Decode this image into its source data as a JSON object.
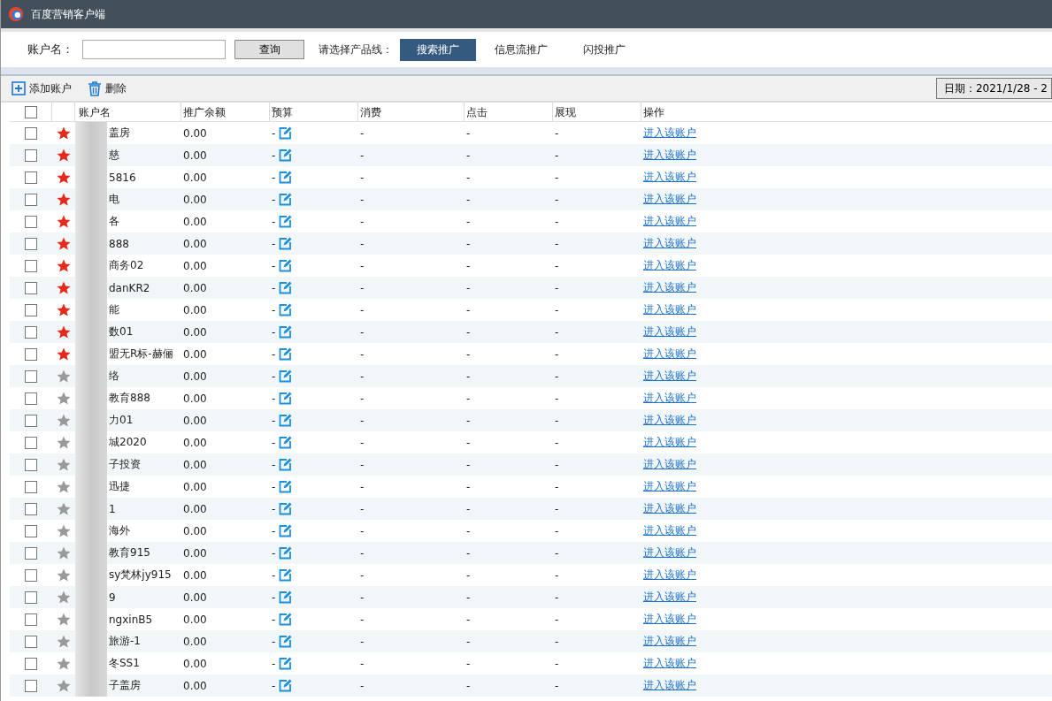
{
  "window": {
    "title": "百度营销客户端"
  },
  "search": {
    "label": "账户名：",
    "button": "查询"
  },
  "product_line": {
    "label": "请选择产品线：",
    "tabs": [
      {
        "label": "搜索推广",
        "selected": true
      },
      {
        "label": "信息流推广",
        "selected": false
      },
      {
        "label": "闪投推广",
        "selected": false
      }
    ]
  },
  "actions": [
    {
      "label": "添加账户",
      "kind": "add"
    },
    {
      "label": "删除",
      "kind": "delete"
    }
  ],
  "date_button": "日期：2021/1/28 - 2",
  "table": {
    "all_checked": false,
    "columns": [
      "账户名",
      "推广余额",
      "预算",
      "消费",
      "点击",
      "展现",
      "操作"
    ],
    "rows": [
      {
        "checked": false,
        "starred": true,
        "name": "盖房",
        "balance": "0.00",
        "budget": "-",
        "spend": "-",
        "clicks": "-",
        "impressions": "-",
        "action": "进入该账户"
      },
      {
        "checked": false,
        "starred": true,
        "name": "慈",
        "balance": "0.00",
        "budget": "-",
        "spend": "-",
        "clicks": "-",
        "impressions": "-",
        "action": "进入该账户"
      },
      {
        "checked": false,
        "starred": true,
        "name": "5816",
        "balance": "0.00",
        "budget": "-",
        "spend": "-",
        "clicks": "-",
        "impressions": "-",
        "action": "进入该账户"
      },
      {
        "checked": false,
        "starred": true,
        "name": "电",
        "balance": "0.00",
        "budget": "-",
        "spend": "-",
        "clicks": "-",
        "impressions": "-",
        "action": "进入该账户"
      },
      {
        "checked": false,
        "starred": true,
        "name": "各",
        "balance": "0.00",
        "budget": "-",
        "spend": "-",
        "clicks": "-",
        "impressions": "-",
        "action": "进入该账户"
      },
      {
        "checked": false,
        "starred": true,
        "name": "888",
        "balance": "0.00",
        "budget": "-",
        "spend": "-",
        "clicks": "-",
        "impressions": "-",
        "action": "进入该账户"
      },
      {
        "checked": false,
        "starred": true,
        "name": "商务02",
        "balance": "0.00",
        "budget": "-",
        "spend": "-",
        "clicks": "-",
        "impressions": "-",
        "action": "进入该账户"
      },
      {
        "checked": false,
        "starred": true,
        "name": "danKR2",
        "balance": "0.00",
        "budget": "-",
        "spend": "-",
        "clicks": "-",
        "impressions": "-",
        "action": "进入该账户"
      },
      {
        "checked": false,
        "starred": true,
        "name": "能",
        "balance": "0.00",
        "budget": "-",
        "spend": "-",
        "clicks": "-",
        "impressions": "-",
        "action": "进入该账户"
      },
      {
        "checked": false,
        "starred": true,
        "name": "数01",
        "balance": "0.00",
        "budget": "-",
        "spend": "-",
        "clicks": "-",
        "impressions": "-",
        "action": "进入该账户"
      },
      {
        "checked": false,
        "starred": true,
        "name": "盟无R标-赫俪",
        "balance": "0.00",
        "budget": "-",
        "spend": "-",
        "clicks": "-",
        "impressions": "-",
        "action": "进入该账户"
      },
      {
        "checked": false,
        "starred": false,
        "name": "络",
        "balance": "0.00",
        "budget": "-",
        "spend": "-",
        "clicks": "-",
        "impressions": "-",
        "action": "进入该账户"
      },
      {
        "checked": false,
        "starred": false,
        "name": "教育888",
        "balance": "0.00",
        "budget": "-",
        "spend": "-",
        "clicks": "-",
        "impressions": "-",
        "action": "进入该账户"
      },
      {
        "checked": false,
        "starred": false,
        "name": "力01",
        "balance": "0.00",
        "budget": "-",
        "spend": "-",
        "clicks": "-",
        "impressions": "-",
        "action": "进入该账户"
      },
      {
        "checked": false,
        "starred": false,
        "name": "城2020",
        "balance": "0.00",
        "budget": "-",
        "spend": "-",
        "clicks": "-",
        "impressions": "-",
        "action": "进入该账户"
      },
      {
        "checked": false,
        "starred": false,
        "name": "子投资",
        "balance": "0.00",
        "budget": "-",
        "spend": "-",
        "clicks": "-",
        "impressions": "-",
        "action": "进入该账户"
      },
      {
        "checked": false,
        "starred": false,
        "name": "迅捷",
        "balance": "0.00",
        "budget": "-",
        "spend": "-",
        "clicks": "-",
        "impressions": "-",
        "action": "进入该账户"
      },
      {
        "checked": false,
        "starred": false,
        "name": "1",
        "balance": "0.00",
        "budget": "-",
        "spend": "-",
        "clicks": "-",
        "impressions": "-",
        "action": "进入该账户"
      },
      {
        "checked": false,
        "starred": false,
        "name": "海外",
        "balance": "0.00",
        "budget": "-",
        "spend": "-",
        "clicks": "-",
        "impressions": "-",
        "action": "进入该账户"
      },
      {
        "checked": false,
        "starred": false,
        "name": "教育915",
        "balance": "0.00",
        "budget": "-",
        "spend": "-",
        "clicks": "-",
        "impressions": "-",
        "action": "进入该账户"
      },
      {
        "checked": false,
        "starred": false,
        "name": "sy梵林jy915",
        "balance": "0.00",
        "budget": "-",
        "spend": "-",
        "clicks": "-",
        "impressions": "-",
        "action": "进入该账户"
      },
      {
        "checked": false,
        "starred": false,
        "name": "9",
        "balance": "0.00",
        "budget": "-",
        "spend": "-",
        "clicks": "-",
        "impressions": "-",
        "action": "进入该账户"
      },
      {
        "checked": false,
        "starred": false,
        "name": "ngxinB5",
        "balance": "0.00",
        "budget": "-",
        "spend": "-",
        "clicks": "-",
        "impressions": "-",
        "action": "进入该账户"
      },
      {
        "checked": false,
        "starred": false,
        "name": "旅游-1",
        "balance": "0.00",
        "budget": "-",
        "spend": "-",
        "clicks": "-",
        "impressions": "-",
        "action": "进入该账户"
      },
      {
        "checked": false,
        "starred": false,
        "name": "冬SS1",
        "balance": "0.00",
        "budget": "-",
        "spend": "-",
        "clicks": "-",
        "impressions": "-",
        "action": "进入该账户"
      },
      {
        "checked": false,
        "starred": false,
        "name": "子盖房",
        "balance": "0.00",
        "budget": "-",
        "spend": "-",
        "clicks": "-",
        "impressions": "-",
        "action": "进入该账户"
      }
    ]
  }
}
